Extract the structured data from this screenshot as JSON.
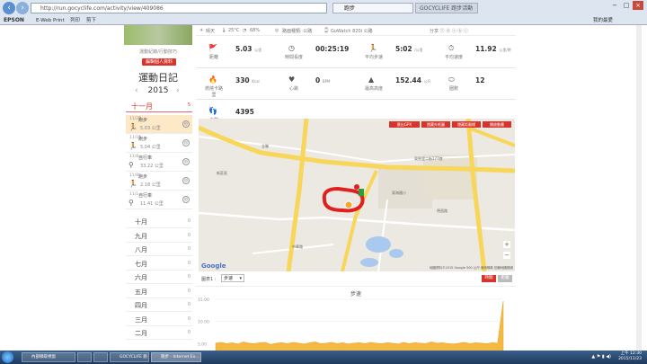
{
  "browser": {
    "url": "http://run.gocyclife.com/activity/view/409086",
    "tab_active": "跑步",
    "tab_other": "GOCYCLIFE 跑步活動",
    "favorites": [
      "EPSON",
      "E-Web Print",
      "列印",
      "剪下",
      "我的最愛"
    ]
  },
  "sidebar": {
    "note": "運動紀錄/行動技巧",
    "edit_button": "編輯個人資料",
    "title": "運動日記",
    "year": "2015",
    "current_month": "十一月",
    "current_count": "5",
    "activities": [
      {
        "date": "11/22",
        "name": "跑步",
        "value": "5.03 公里",
        "icon": "run-icon",
        "selected": true
      },
      {
        "date": "11/15",
        "name": "跑步",
        "value": "5.04 公里",
        "icon": "run-icon",
        "selected": false
      },
      {
        "date": "11/8",
        "name": "自行車",
        "value": "33.22 公里",
        "icon": "bike-icon",
        "selected": false
      },
      {
        "date": "11/8",
        "name": "跑步",
        "value": "2.18 公里",
        "icon": "run-icon",
        "selected": false
      },
      {
        "date": "11/1",
        "name": "自行車",
        "value": "11.41 公里",
        "icon": "bike-icon",
        "selected": false
      }
    ],
    "months": [
      {
        "label": "十月",
        "count": "0"
      },
      {
        "label": "九月",
        "count": "0"
      },
      {
        "label": "八月",
        "count": "0"
      },
      {
        "label": "七月",
        "count": "0"
      },
      {
        "label": "六月",
        "count": "0"
      },
      {
        "label": "五月",
        "count": "0"
      },
      {
        "label": "四月",
        "count": "0"
      },
      {
        "label": "三月",
        "count": "0"
      },
      {
        "label": "二月",
        "count": "0"
      }
    ]
  },
  "topinfo": {
    "weather": "晴天",
    "temp": "25°C",
    "humidity": "68%",
    "terrain": "路面種類: 公路",
    "device": "GoWatch 820i 公路"
  },
  "stats": [
    {
      "label": "距離",
      "value": "5.03",
      "unit": "公里",
      "icon": "distance-icon"
    },
    {
      "label": "時間長度",
      "value": "00:25:19",
      "unit": "",
      "icon": "clock-icon"
    },
    {
      "label": "平均步速",
      "value": "5:02",
      "unit": "/公里",
      "icon": "pace-icon"
    },
    {
      "label": "平均速度",
      "value": "11.92",
      "unit": "公里/時",
      "icon": "speed-icon"
    },
    {
      "label": "燃燒卡路里",
      "value": "330",
      "unit": "Kcal",
      "icon": "flame-icon"
    },
    {
      "label": "心跳",
      "value": "0",
      "unit": "BPM",
      "icon": "heart-icon"
    },
    {
      "label": "最高高度",
      "value": "152.44",
      "unit": "公尺",
      "icon": "mountain-icon"
    },
    {
      "label": "圈數",
      "value": "12",
      "unit": "",
      "icon": "lap-icon"
    },
    {
      "label": "步數",
      "value": "4395",
      "unit": "",
      "icon": "steps-icon"
    }
  ],
  "map": {
    "buttons": [
      "匯出GPX",
      "隱藏外框圖",
      "隱藏距離標",
      "播放動畫"
    ],
    "labels": [
      "東原里二街177巷",
      "全聯",
      "東海國小",
      "新莊區",
      "中華路",
      "德昌路"
    ],
    "footer": "地圖資料©2015 Google  500 公尺  使用條款  回報地圖錯誤",
    "google": "Google",
    "zoom_in": "+",
    "zoom_out": "−"
  },
  "chart_controls": {
    "label": "圖表1 :",
    "select_value": "步速",
    "btn_time": "時間",
    "btn_dist": "距離"
  },
  "chart_data": {
    "type": "area",
    "title": "步速",
    "xlabel": "",
    "ylabel": "",
    "ylim": [
      0,
      15
    ],
    "yticks": [
      "15.00",
      "10.00",
      "5.00"
    ],
    "series": [
      {
        "values": [
          5.1,
          5.3,
          5.0,
          5.2,
          4.9,
          5.4,
          5.1,
          5.0,
          5.2,
          5.3,
          4.8,
          5.1,
          5.2,
          5.0,
          5.3,
          5.1,
          4.9,
          5.2,
          5.4,
          5.0,
          5.1,
          5.3,
          5.0,
          5.2,
          4.9,
          5.1,
          5.2,
          5.0,
          5.3,
          5.1,
          5.0,
          5.2,
          5.1,
          4.9,
          5.3,
          5.0,
          5.2,
          5.1,
          5.0,
          5.4,
          5.1,
          5.2,
          5.0,
          4.9,
          5.1,
          5.3,
          5.0,
          5.2,
          5.1,
          5.0,
          5.2,
          5.1,
          14.6
        ]
      }
    ]
  },
  "taskbar": {
    "items": [
      "內部擷取視窗",
      "",
      "",
      "GOCYCLIFE 跑步活動",
      "跑步 - Internet Ex..."
    ],
    "clock_time": "上午 12:30",
    "clock_date": "2015/11/23"
  },
  "colors": {
    "accent": "#d9342b",
    "chart_fill": "#f4b942",
    "route": "#e02020"
  }
}
